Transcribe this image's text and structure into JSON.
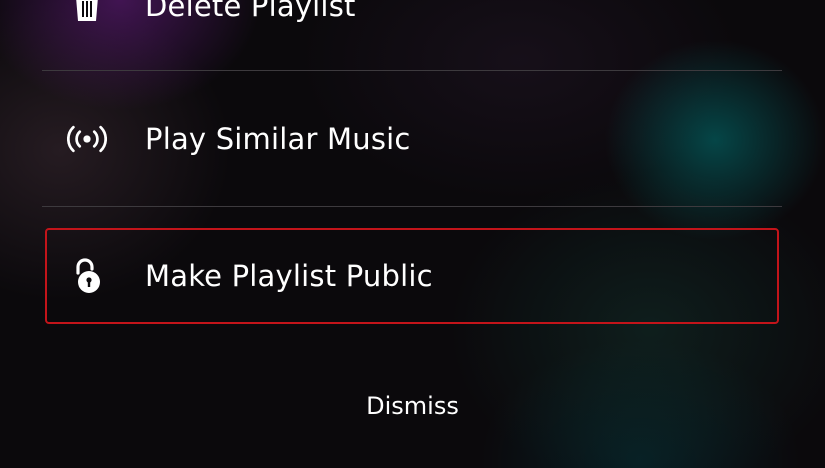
{
  "menu": {
    "items": [
      {
        "label": "Delete Playlist",
        "icon": "trash-icon"
      },
      {
        "label": "Play Similar Music",
        "icon": "radio-waves-icon"
      },
      {
        "label": "Make Playlist Public",
        "icon": "unlock-icon",
        "focused": true
      }
    ],
    "dismiss_label": "Dismiss"
  },
  "colors": {
    "background": "#0b090c",
    "text": "#ffffff",
    "divider": "#3d3a3e",
    "focus_border": "#c3141a"
  }
}
